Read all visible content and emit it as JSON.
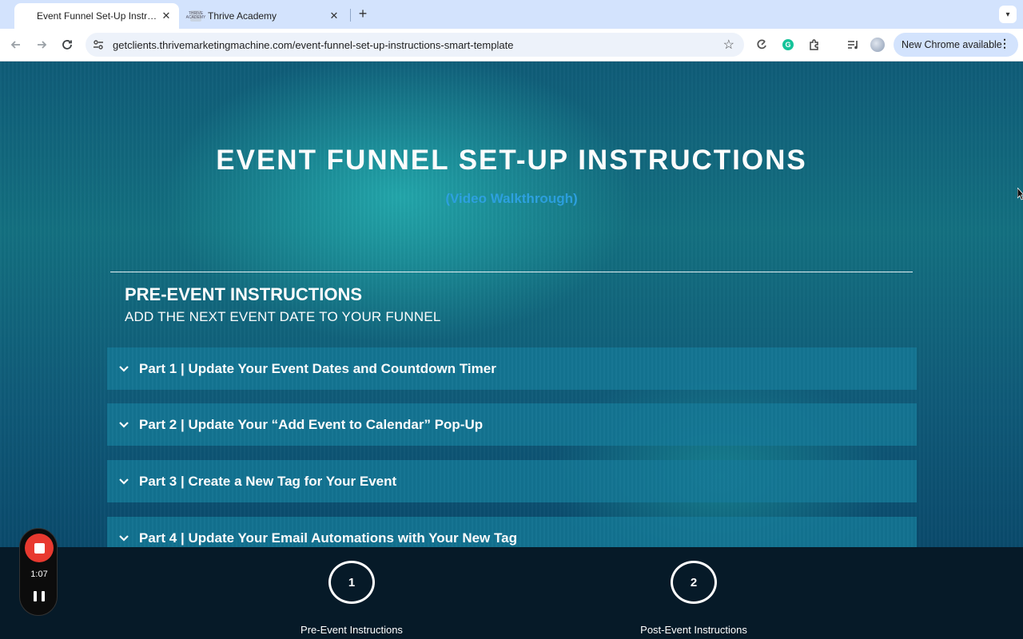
{
  "browser": {
    "tabs": [
      {
        "title": "Event Funnel Set-Up Instructi",
        "active": true
      },
      {
        "title": "Thrive Academy",
        "active": false,
        "favicon_text": "THRIVE ACADEMY"
      }
    ],
    "new_tab_label": "+",
    "url": "getclients.thrivemarketingmachine.com/event-funnel-set-up-instructions-smart-template",
    "chrome_update_label": "New Chrome available",
    "icons": [
      "back-icon",
      "forward-icon",
      "reload-icon",
      "site-info-icon",
      "bookmark-star-icon",
      "extension-refresh-icon",
      "grammarly-icon",
      "extensions-puzzle-icon",
      "media-queue-icon",
      "profile-avatar-icon",
      "kebab-menu-icon",
      "tab-search-icon"
    ]
  },
  "page": {
    "title": "EVENT FUNNEL SET-UP INSTRUCTIONS",
    "video_link": "(Video Walkthrough)",
    "section_heading": "PRE-EVENT INSTRUCTIONS",
    "section_subheading": "ADD THE NEXT EVENT DATE TO YOUR FUNNEL",
    "accordion_items": [
      {
        "label": "Part 1 | Update Your Event Dates and Countdown Timer"
      },
      {
        "label": "Part 2 | Update Your “Add Event to Calendar” Pop-Up"
      },
      {
        "label": "Part 3 | Create a New Tag for Your Event"
      },
      {
        "label": "Part 4 | Update Your Email Automations with Your New Tag"
      }
    ]
  },
  "steps": [
    {
      "number": "1",
      "label": "Pre-Event Instructions"
    },
    {
      "number": "2",
      "label": "Post-Event Instructions"
    }
  ],
  "recorder": {
    "elapsed": "1:07"
  },
  "colors": {
    "accent_link": "#2ba0e0",
    "record_red": "#e8392f",
    "accordion_bg": "#14789a",
    "bottom_bar": "#061a28"
  }
}
